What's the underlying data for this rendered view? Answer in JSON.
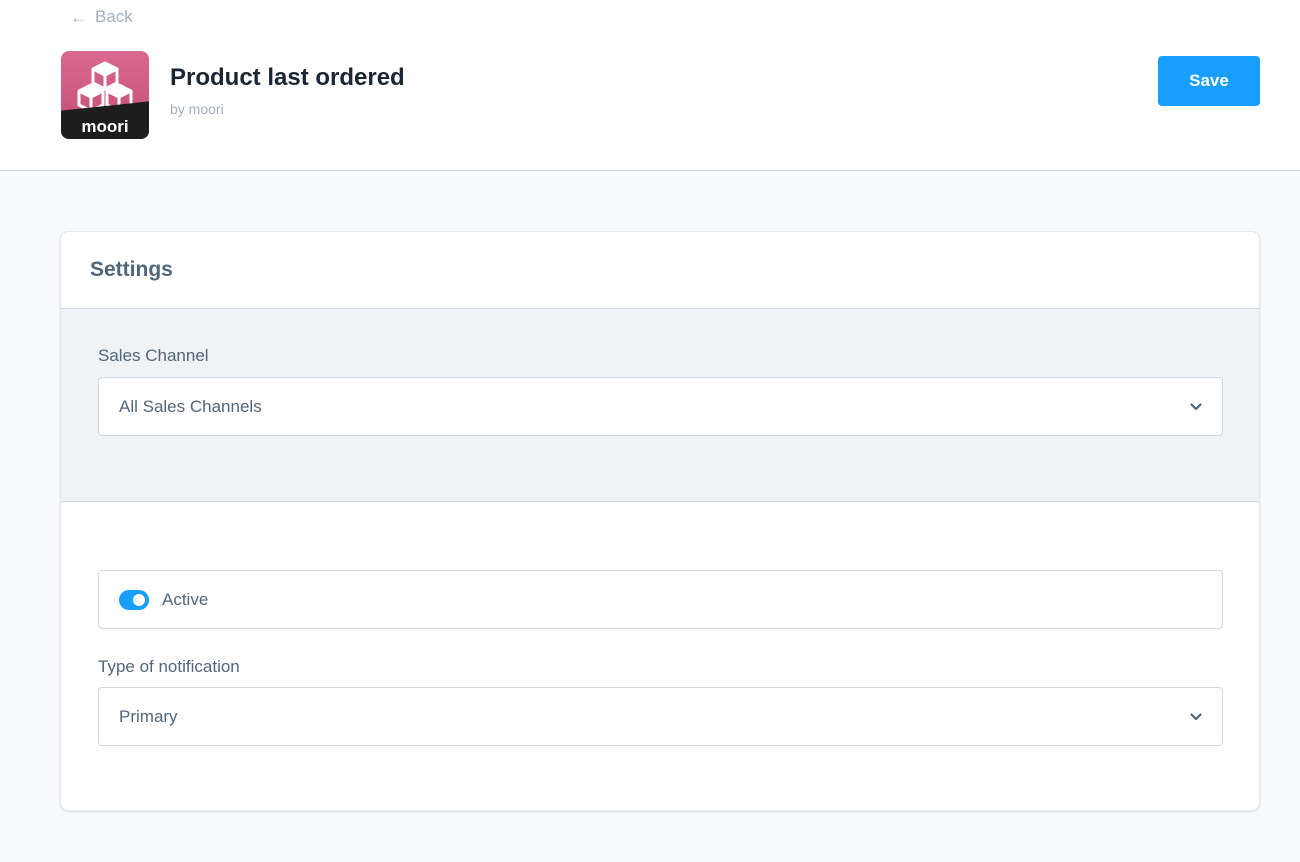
{
  "nav": {
    "back_label": "Back"
  },
  "app": {
    "title": "Product last ordered",
    "author": "by moori",
    "icon_brand": "moori",
    "save_label": "Save"
  },
  "settings": {
    "heading": "Settings",
    "sales_channel": {
      "label": "Sales Channel",
      "value": "All Sales Channels"
    },
    "active": {
      "label": "Active",
      "checked": true
    },
    "notification_type": {
      "label": "Type of notification",
      "value": "Primary"
    }
  },
  "colors": {
    "accent": "#189eff",
    "title": "#1a2733",
    "text": "#52667a",
    "muted": "#a3b0bd",
    "icon_bg": "#c24c74"
  }
}
